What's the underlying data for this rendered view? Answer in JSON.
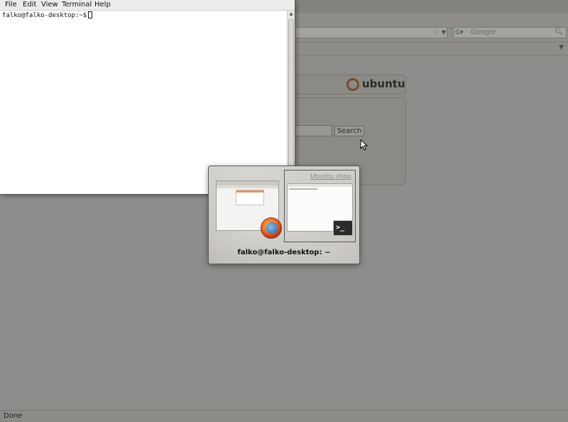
{
  "browser": {
    "search_placeholder": "Google",
    "logo_text": "ubuntu",
    "search_button": "Search",
    "status": "Done"
  },
  "terminal": {
    "menu": {
      "file": "File",
      "edit": "Edit",
      "view": "View",
      "terminal": "Terminal",
      "help": "Help"
    },
    "prompt": "falko@falko-desktop:~$"
  },
  "switcher": {
    "link_text": "Ubuntu shop",
    "selected_title": "falko@falko-desktop: ~",
    "terminal_icon_glyph": ">_"
  }
}
